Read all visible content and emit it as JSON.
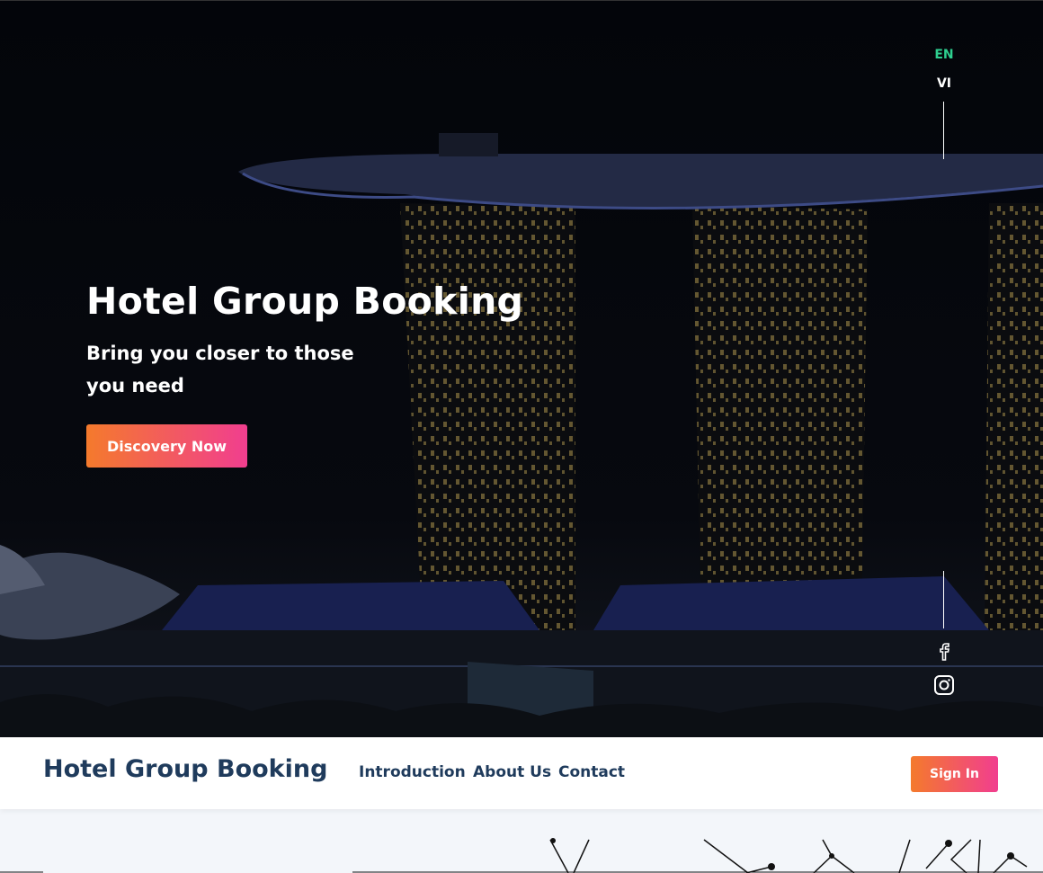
{
  "hero": {
    "title": "Hotel Group Booking",
    "subtitle": "Bring you closer to those you need",
    "cta_label": "Discovery Now"
  },
  "language": {
    "options": [
      "EN",
      "VI"
    ],
    "active": "EN"
  },
  "social": {
    "icons": [
      "facebook-icon",
      "instagram-icon"
    ]
  },
  "navbar": {
    "brand": "Hotel Group Booking",
    "links": [
      "Introduction",
      "About Us",
      "Contact"
    ],
    "signin_label": "Sign In"
  },
  "colors": {
    "accent_start": "#f47a2c",
    "accent_end": "#f13e8f",
    "active_language": "#2ecf8f",
    "brand_text": "#1f3b5c"
  }
}
